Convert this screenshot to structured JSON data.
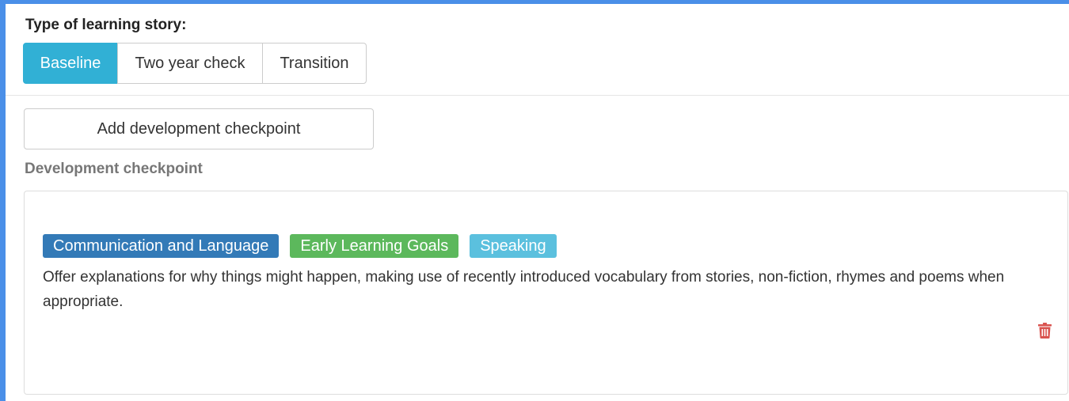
{
  "story_type": {
    "label": "Type of learning story:",
    "options": [
      "Baseline",
      "Two year check",
      "Transition"
    ],
    "selected": "Baseline"
  },
  "add_checkpoint_label": "Add development checkpoint",
  "checkpoint": {
    "heading": "Development checkpoint",
    "tags": [
      {
        "text": "Communication and Language",
        "color": "#337ab7"
      },
      {
        "text": "Early Learning Goals",
        "color": "#5cb85c"
      },
      {
        "text": "Speaking",
        "color": "#5bc0de"
      }
    ],
    "description": "Offer explanations for why things might happen, making use of recently introduced vocabulary from stories, non-fiction, rhymes and poems when appropriate.",
    "delete_icon": "trash-icon",
    "delete_icon_color": "#d9534f"
  },
  "colors": {
    "accent": "#31b0d5",
    "frame": "#4a8fe8"
  }
}
